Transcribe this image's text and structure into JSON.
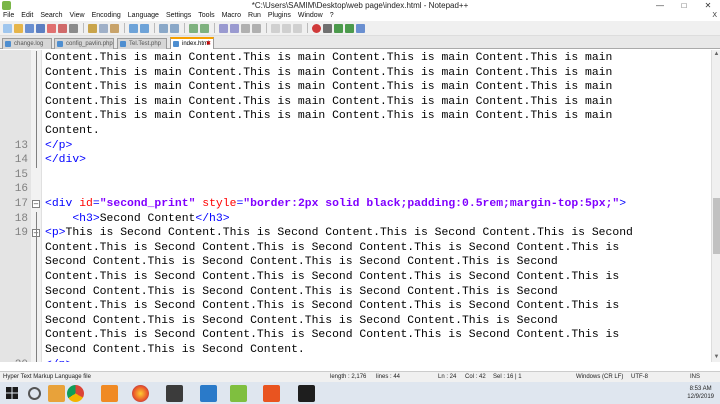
{
  "window": {
    "title": "*C:\\Users\\SAMIM\\Desktop\\web page\\index.html - Notepad++"
  },
  "menu": [
    "File",
    "Edit",
    "Search",
    "View",
    "Encoding",
    "Language",
    "Settings",
    "Tools",
    "Macro",
    "Run",
    "Plugins",
    "Window",
    "?"
  ],
  "menu_close": "X",
  "tabs": [
    {
      "label": "change.log"
    },
    {
      "label": "config_pavlin.php"
    },
    {
      "label": "Tel.Test.php"
    },
    {
      "label": "index.html",
      "active": true
    }
  ],
  "editor": {
    "lines": [
      {
        "n": "",
        "segs": [
          {
            "t": "Content.This is main Content.This is main Content.This is main Content.This is main",
            "c": ""
          }
        ]
      },
      {
        "n": "",
        "segs": [
          {
            "t": "Content.This is main Content.This is main Content.This is main Content.This is main",
            "c": ""
          }
        ]
      },
      {
        "n": "",
        "segs": [
          {
            "t": "Content.This is main Content.This is main Content.This is main Content.This is main",
            "c": ""
          }
        ]
      },
      {
        "n": "",
        "segs": [
          {
            "t": "Content.This is main Content.This is main Content.This is main Content.This is main",
            "c": ""
          }
        ]
      },
      {
        "n": "",
        "segs": [
          {
            "t": "Content.This is main Content.This is main Content.This is main Content.This is main",
            "c": ""
          }
        ]
      },
      {
        "n": "",
        "segs": [
          {
            "t": "Content.",
            "c": ""
          }
        ]
      },
      {
        "n": "13",
        "segs": [
          {
            "t": "</p>",
            "c": "tag"
          }
        ]
      },
      {
        "n": "14",
        "segs": [
          {
            "t": "</div>",
            "c": "tag"
          }
        ]
      },
      {
        "n": "15",
        "segs": []
      },
      {
        "n": "16",
        "segs": []
      },
      {
        "n": "17",
        "segs": [
          {
            "t": "<div ",
            "c": "tag"
          },
          {
            "t": "id",
            "c": "attr"
          },
          {
            "t": "=",
            "c": "tag"
          },
          {
            "t": "\"second_print\"",
            "c": "str"
          },
          {
            "t": " ",
            "c": ""
          },
          {
            "t": "style",
            "c": "attr"
          },
          {
            "t": "=",
            "c": "tag"
          },
          {
            "t": "\"border:2px solid black;padding:0.5rem;margin-top:5px;\"",
            "c": "str"
          },
          {
            "t": ">",
            "c": "tag"
          }
        ]
      },
      {
        "n": "18",
        "segs": [
          {
            "t": "    ",
            "c": ""
          },
          {
            "t": "<h3>",
            "c": "tag"
          },
          {
            "t": "Second Content",
            "c": ""
          },
          {
            "t": "</h3>",
            "c": "tag"
          }
        ]
      },
      {
        "n": "19",
        "segs": [
          {
            "t": "<p>",
            "c": "tag"
          },
          {
            "t": "This is Second Content.This is Second Content.This is Second Content.This is Second",
            "c": ""
          }
        ]
      },
      {
        "n": "",
        "segs": [
          {
            "t": "Content.This is Second Content.This is Second Content.This is Second Content.This is",
            "c": ""
          }
        ]
      },
      {
        "n": "",
        "segs": [
          {
            "t": "Second Content.This is Second Content.This is Second Content.This is Second",
            "c": ""
          }
        ]
      },
      {
        "n": "",
        "segs": [
          {
            "t": "Content.This is Second Content.This is Second Content.This is Second Content.This is",
            "c": ""
          }
        ]
      },
      {
        "n": "",
        "segs": [
          {
            "t": "Second Content.This is Second Content.This is Second Content.This is Second",
            "c": ""
          }
        ]
      },
      {
        "n": "",
        "segs": [
          {
            "t": "Content.This is Second Content.This is Second Content.This is Second Content.This is",
            "c": ""
          }
        ]
      },
      {
        "n": "",
        "segs": [
          {
            "t": "Second Content.This is Second Content.This is Second Content.This is Second",
            "c": ""
          }
        ]
      },
      {
        "n": "",
        "segs": [
          {
            "t": "Content.This is Second Content.This is Second Content.This is Second Content.This is",
            "c": ""
          }
        ]
      },
      {
        "n": "",
        "segs": [
          {
            "t": "Second Content.This is Second Content.",
            "c": ""
          }
        ]
      },
      {
        "n": "20",
        "segs": [
          {
            "t": "</p>",
            "c": "tag"
          }
        ]
      }
    ]
  },
  "status": {
    "file_type": "Hyper Text Markup Language file",
    "length": "length : 2,176",
    "lines": "lines : 44",
    "position": "Ln : 24",
    "col": "Col : 42",
    "sel": "Sel : 16 | 1",
    "eol": "Windows (CR LF)",
    "encoding": "UTF-8",
    "mode": "INS"
  },
  "taskbar": {
    "time": "8:53 AM",
    "date": "12/9/2019"
  },
  "colors": {
    "tag": "#0000ff",
    "attr": "#ff0000",
    "str": "#8000ff",
    "tab_accent": "#f6a000"
  }
}
